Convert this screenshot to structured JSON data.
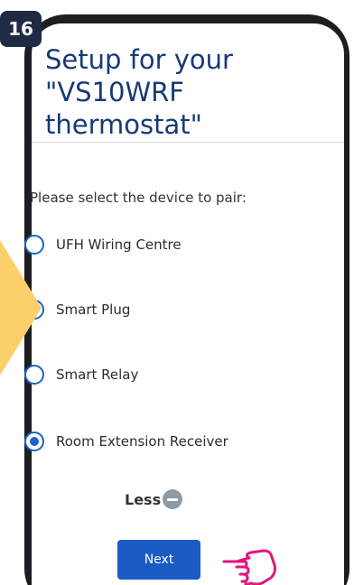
{
  "step_badge": "16",
  "title": {
    "line1": "Setup for your",
    "line2": "\"VS10WRF",
    "line3": "thermostat\""
  },
  "prompt": "Please select the device to pair:",
  "options": [
    {
      "label": "UFH Wiring Centre",
      "selected": false
    },
    {
      "label": "Smart Plug",
      "selected": false
    },
    {
      "label": "Smart Relay",
      "selected": false
    },
    {
      "label": "Room Extension Receiver",
      "selected": true
    }
  ],
  "less_toggle": {
    "label": "Less",
    "icon": "minus-icon"
  },
  "next_button": {
    "label": "Next"
  },
  "icons": {
    "pointer": "hand-pointer-icon",
    "arrow": "yellow-arrow-icon"
  },
  "colors": {
    "title": "#163a74",
    "accent": "#1a64c8",
    "button": "#1a5bc4",
    "badge": "#1f2a44",
    "arrow": "#fbd06a",
    "hand": "#e3157d"
  }
}
